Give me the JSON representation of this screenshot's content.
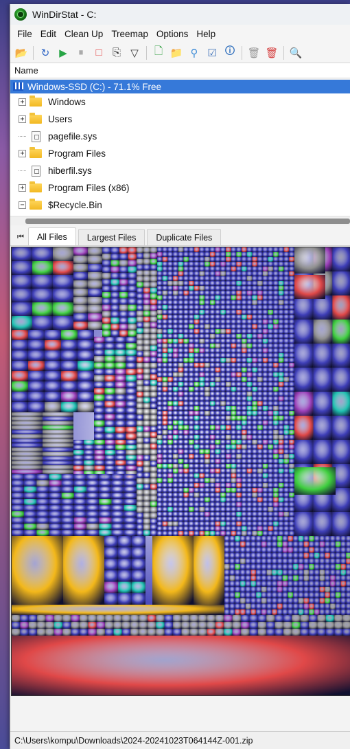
{
  "window": {
    "title": "WinDirStat - C:"
  },
  "menu": [
    "File",
    "Edit",
    "Clean Up",
    "Treemap",
    "Options",
    "Help"
  ],
  "toolbar": {
    "buttons": [
      {
        "icon": "open-folder-icon",
        "glyph": "📂",
        "color": "#d49b1f"
      },
      {
        "sep": true
      },
      {
        "icon": "refresh-icon",
        "glyph": "↻",
        "color": "#2a62c4"
      },
      {
        "icon": "play-icon",
        "glyph": "▶",
        "color": "#27a545"
      },
      {
        "icon": "pause-icon",
        "glyph": "⏸",
        "color": "#8a8a8a"
      },
      {
        "icon": "stop-icon",
        "glyph": "□",
        "color": "#e23b3b"
      },
      {
        "icon": "copy-path-icon",
        "glyph": "⎘",
        "color": "#333333"
      },
      {
        "icon": "filter-icon",
        "glyph": "▽",
        "color": "#333333"
      },
      {
        "sep": true
      },
      {
        "icon": "new-file-icon",
        "glyph": "🗋",
        "color": "#2c9c3c"
      },
      {
        "icon": "explorer-icon",
        "glyph": "📁",
        "color": "#e0a324"
      },
      {
        "icon": "command-prompt-icon",
        "glyph": "⚲",
        "color": "#3b8bd6"
      },
      {
        "icon": "properties-icon",
        "glyph": "☑",
        "color": "#3b6fb8"
      },
      {
        "icon": "info-icon",
        "glyph": "🛈",
        "color": "#2f6fbd"
      },
      {
        "sep": true
      },
      {
        "icon": "recycle-bin-icon",
        "glyph": "🗑",
        "color": "#9a9a9a"
      },
      {
        "icon": "delete-icon",
        "glyph": "🗑",
        "color": "#d64545"
      },
      {
        "sep": true
      },
      {
        "icon": "zoom-in-icon",
        "glyph": "🔍",
        "color": "#333333"
      }
    ]
  },
  "list_header": {
    "name": "Name"
  },
  "tree": {
    "root": "Windows-SSD (C:) - 71.1% Free",
    "items": [
      {
        "label": "Windows",
        "type": "folder",
        "expandable": true
      },
      {
        "label": "Users",
        "type": "folder",
        "expandable": true
      },
      {
        "label": "pagefile.sys",
        "type": "file",
        "expandable": false
      },
      {
        "label": "Program Files",
        "type": "folder",
        "expandable": true
      },
      {
        "label": "hiberfil.sys",
        "type": "file",
        "expandable": false
      },
      {
        "label": "Program Files (x86)",
        "type": "folder",
        "expandable": true
      },
      {
        "label": "$Recycle.Bin",
        "type": "folder",
        "expandable": true,
        "expanded": true
      }
    ]
  },
  "tabs": [
    "All Files",
    "Largest Files",
    "Duplicate Files"
  ],
  "active_tab": "All Files",
  "status": {
    "path": "C:\\Users\\kompu\\Downloads\\2024-20241023T064144Z-001.zip"
  },
  "colors": {
    "selection": "#3679d9",
    "treemap_blue": "#3f3fb8",
    "treemap_gray": "#8e8e8e",
    "treemap_yellow": "#f3b81a",
    "treemap_red": "#e04848",
    "treemap_green": "#3fcf3f",
    "treemap_teal": "#1fc0b0",
    "treemap_purple": "#9b3fb8"
  }
}
